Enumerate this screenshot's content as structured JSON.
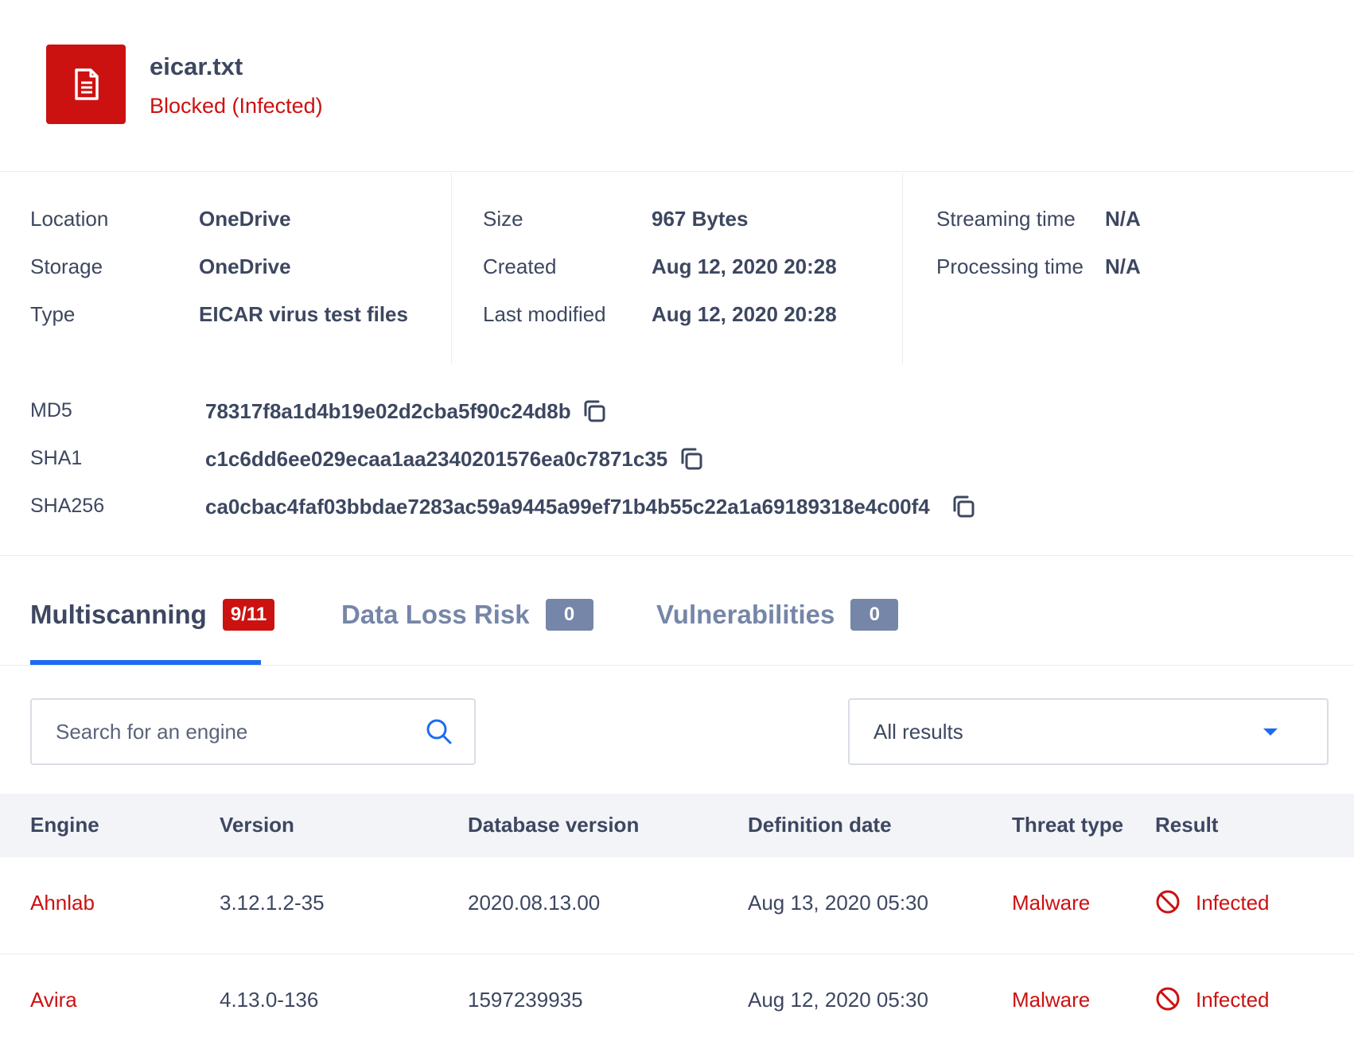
{
  "file": {
    "name": "eicar.txt",
    "status": "Blocked (Infected)"
  },
  "info": {
    "col1": [
      {
        "label": "Location",
        "value": "OneDrive"
      },
      {
        "label": "Storage",
        "value": "OneDrive"
      },
      {
        "label": "Type",
        "value": "EICAR virus test files"
      }
    ],
    "col2": [
      {
        "label": "Size",
        "value": "967 Bytes"
      },
      {
        "label": "Created",
        "value": "Aug 12, 2020 20:28"
      },
      {
        "label": "Last modified",
        "value": "Aug 12, 2020 20:28"
      }
    ],
    "col3": [
      {
        "label": "Streaming time",
        "value": "N/A"
      },
      {
        "label": "Processing time",
        "value": "N/A"
      }
    ]
  },
  "hashes": [
    {
      "label": "MD5",
      "value": "78317f8a1d4b19e02d2cba5f90c24d8b"
    },
    {
      "label": "SHA1",
      "value": "c1c6dd6ee029ecaa1aa2340201576ea0c7871c35"
    },
    {
      "label": "SHA256",
      "value": "ca0cbac4faf03bbdae7283ac59a9445a99ef71b4b55c22a1a69189318e4c00f4"
    }
  ],
  "tabs": [
    {
      "label": "Multiscanning",
      "badge": "9/11"
    },
    {
      "label": "Data Loss Risk",
      "badge": "0"
    },
    {
      "label": "Vulnerabilities",
      "badge": "0"
    }
  ],
  "filters": {
    "search_placeholder": "Search for an engine",
    "select_value": "All results"
  },
  "table": {
    "headers": [
      "Engine",
      "Version",
      "Database version",
      "Definition date",
      "Threat type",
      "Result"
    ],
    "rows": [
      {
        "engine": "Ahnlab",
        "version": "3.12.1.2-35",
        "db_version": "2020.08.13.00",
        "def_date": "Aug 13, 2020 05:30",
        "threat": "Malware",
        "result": "Infected"
      },
      {
        "engine": "Avira",
        "version": "4.13.0-136",
        "db_version": "1597239935",
        "def_date": "Aug 12, 2020 05:30",
        "threat": "Malware",
        "result": "Infected"
      }
    ]
  },
  "colors": {
    "danger": "#cc1111",
    "accent": "#1d6bf2",
    "text": "#3d4760",
    "muted": "#7686a8"
  },
  "icons": {
    "file": "document-icon",
    "copy": "copy-icon",
    "search": "search-icon",
    "dropdown": "chevron-down-icon",
    "result": "blocked-icon"
  }
}
